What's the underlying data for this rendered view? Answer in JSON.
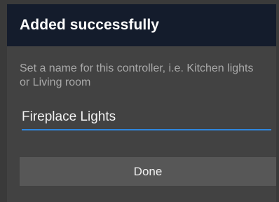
{
  "dialog": {
    "title": "Added successfully",
    "hint": "Set a name for this controller, i.e. Kitchen lights or Living room",
    "name_value": "Fireplace Lights",
    "done_label": "Done",
    "accent_color": "#2f87de",
    "header_color": "#141c2c"
  }
}
